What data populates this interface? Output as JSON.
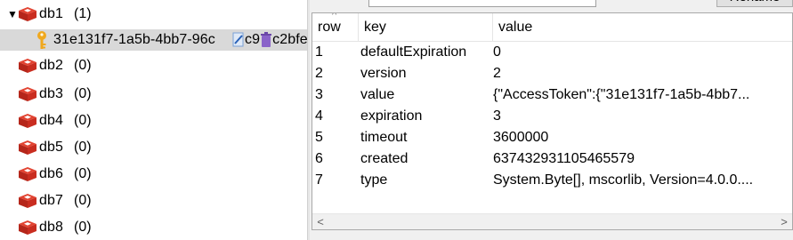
{
  "tree": {
    "databases": [
      {
        "label": "db1",
        "count": "(1)",
        "expanded": true
      },
      {
        "label": "db2",
        "count": "(0)"
      },
      {
        "label": "db3",
        "count": "(0)"
      },
      {
        "label": "db4",
        "count": "(0)"
      },
      {
        "label": "db5",
        "count": "(0)"
      },
      {
        "label": "db6",
        "count": "(0)"
      },
      {
        "label": "db7",
        "count": "(0)"
      },
      {
        "label": "db8",
        "count": "(0)"
      }
    ],
    "expander": "▼",
    "selected_key": {
      "text": "31e131f7-1a5b-4bb7-96c",
      "text_tail_a": "c9",
      "text_tail_b": "c2bfe"
    }
  },
  "toolbar": {
    "rename_label": "Rename"
  },
  "grid": {
    "columns": [
      "row",
      "key",
      "value"
    ],
    "sort_glyph": "^",
    "rows": [
      [
        "1",
        "defaultExpiration",
        "0"
      ],
      [
        "2",
        "version",
        "2"
      ],
      [
        "3",
        "value",
        "{\"AccessToken\":{\"31e131f7-1a5b-4bb7..."
      ],
      [
        "4",
        "expiration",
        "3"
      ],
      [
        "5",
        "timeout",
        "3600000"
      ],
      [
        "6",
        "created",
        "637432931105465579"
      ],
      [
        "7",
        "type",
        "System.Byte[], mscorlib, Version=4.0.0...."
      ]
    ]
  },
  "scrollbar": {
    "left": "<",
    "right": ">"
  },
  "colors": {
    "redis_red": "#d82c20",
    "key_gold": "#f0a81e",
    "selection": "#d9d9d9"
  }
}
